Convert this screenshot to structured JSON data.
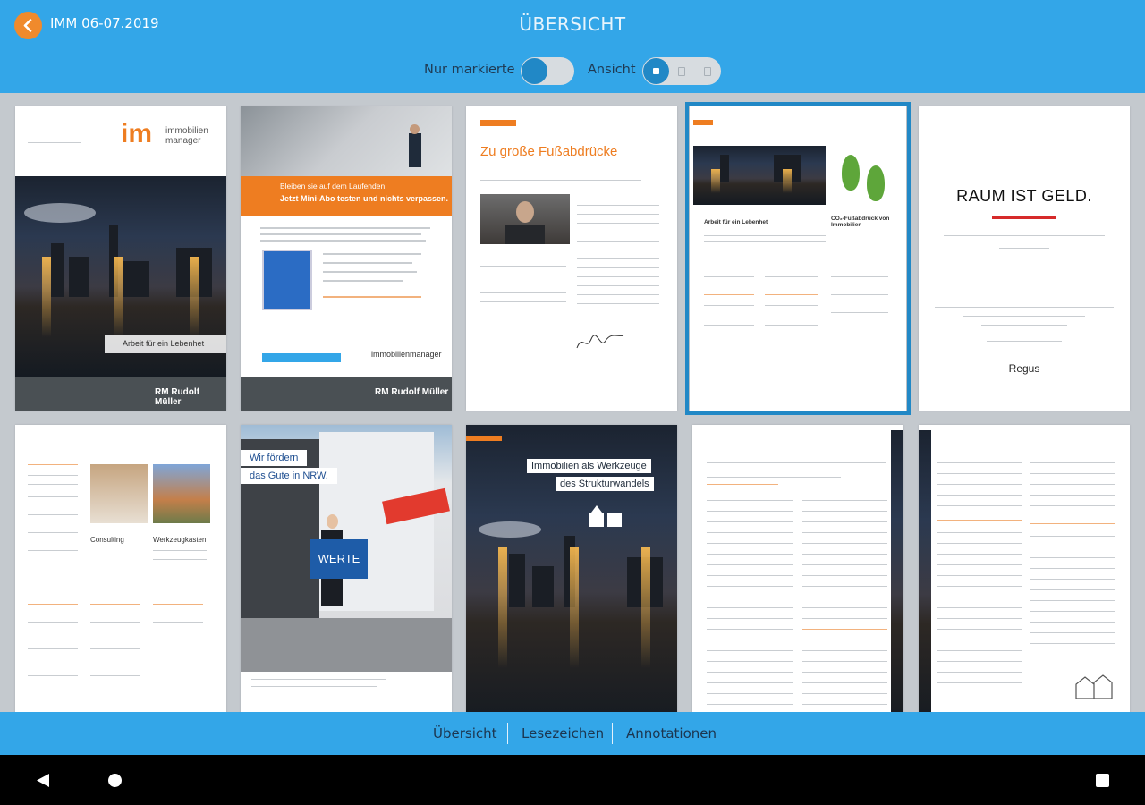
{
  "header": {
    "issue_title": "IMM 06-07.2019",
    "page_title": "ÜBERSICHT",
    "only_marked_label": "Nur markierte",
    "view_label": "Ansicht"
  },
  "colors": {
    "header_bg": "#33a6e8",
    "accent": "#f08a2c",
    "selection": "#2188c6",
    "grid_bg": "#c4c9ce"
  },
  "pages": {
    "p1": {
      "logo": "im",
      "logo_text_1": "immobilien",
      "logo_text_2": "manager",
      "caption": "Arbeit für ein Lebenhet",
      "footer": "RM Rudolf Müller"
    },
    "p2": {
      "headline_1": "Bleiben sie auf dem Laufenden!",
      "headline_2": "Jetzt Mini-Abo testen und nichts verpassen.",
      "brand": "immobilienmanager",
      "footer": "RM Rudolf Müller"
    },
    "p3": {
      "title": "Zu große Fußabdrücke"
    },
    "p4": {
      "heading": "Arbeit für ein Lebenhet",
      "heading2": "CO₂-Fußabdruck von Immobilien"
    },
    "p5": {
      "headline": "RAUM IST GELD.",
      "brand": "Regus"
    },
    "p6": {
      "col1": "Consulting",
      "col2": "Werkzeugkasten"
    },
    "p7": {
      "slogan_1": "Wir fördern",
      "slogan_2": "das Gute in NRW.",
      "sign": "WERTE"
    },
    "p8": {
      "title_1": "Immobilien als Werkzeuge",
      "title_2": "des Strukturwandels"
    }
  },
  "tabs": {
    "overview": "Übersicht",
    "bookmarks": "Lesezeichen",
    "annotations": "Annotationen"
  },
  "system_nav": {
    "back": "back-icon",
    "home": "home-icon",
    "recents": "recents-icon"
  }
}
